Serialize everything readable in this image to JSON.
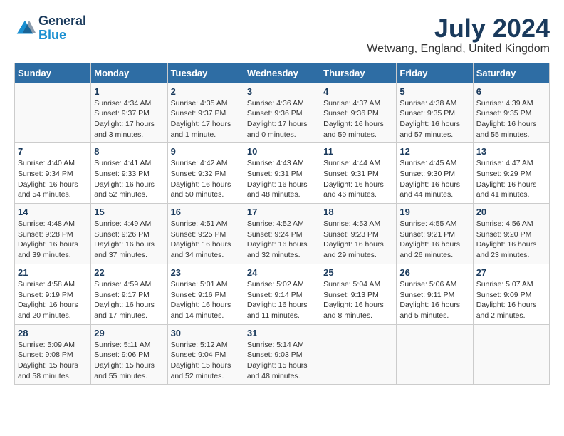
{
  "header": {
    "logo_general": "General",
    "logo_blue": "Blue",
    "title": "July 2024",
    "subtitle": "Wetwang, England, United Kingdom"
  },
  "days_of_week": [
    "Sunday",
    "Monday",
    "Tuesday",
    "Wednesday",
    "Thursday",
    "Friday",
    "Saturday"
  ],
  "weeks": [
    [
      {
        "day": "",
        "text": ""
      },
      {
        "day": "1",
        "text": "Sunrise: 4:34 AM\nSunset: 9:37 PM\nDaylight: 17 hours\nand 3 minutes."
      },
      {
        "day": "2",
        "text": "Sunrise: 4:35 AM\nSunset: 9:37 PM\nDaylight: 17 hours\nand 1 minute."
      },
      {
        "day": "3",
        "text": "Sunrise: 4:36 AM\nSunset: 9:36 PM\nDaylight: 17 hours\nand 0 minutes."
      },
      {
        "day": "4",
        "text": "Sunrise: 4:37 AM\nSunset: 9:36 PM\nDaylight: 16 hours\nand 59 minutes."
      },
      {
        "day": "5",
        "text": "Sunrise: 4:38 AM\nSunset: 9:35 PM\nDaylight: 16 hours\nand 57 minutes."
      },
      {
        "day": "6",
        "text": "Sunrise: 4:39 AM\nSunset: 9:35 PM\nDaylight: 16 hours\nand 55 minutes."
      }
    ],
    [
      {
        "day": "7",
        "text": "Sunrise: 4:40 AM\nSunset: 9:34 PM\nDaylight: 16 hours\nand 54 minutes."
      },
      {
        "day": "8",
        "text": "Sunrise: 4:41 AM\nSunset: 9:33 PM\nDaylight: 16 hours\nand 52 minutes."
      },
      {
        "day": "9",
        "text": "Sunrise: 4:42 AM\nSunset: 9:32 PM\nDaylight: 16 hours\nand 50 minutes."
      },
      {
        "day": "10",
        "text": "Sunrise: 4:43 AM\nSunset: 9:31 PM\nDaylight: 16 hours\nand 48 minutes."
      },
      {
        "day": "11",
        "text": "Sunrise: 4:44 AM\nSunset: 9:31 PM\nDaylight: 16 hours\nand 46 minutes."
      },
      {
        "day": "12",
        "text": "Sunrise: 4:45 AM\nSunset: 9:30 PM\nDaylight: 16 hours\nand 44 minutes."
      },
      {
        "day": "13",
        "text": "Sunrise: 4:47 AM\nSunset: 9:29 PM\nDaylight: 16 hours\nand 41 minutes."
      }
    ],
    [
      {
        "day": "14",
        "text": "Sunrise: 4:48 AM\nSunset: 9:28 PM\nDaylight: 16 hours\nand 39 minutes."
      },
      {
        "day": "15",
        "text": "Sunrise: 4:49 AM\nSunset: 9:26 PM\nDaylight: 16 hours\nand 37 minutes."
      },
      {
        "day": "16",
        "text": "Sunrise: 4:51 AM\nSunset: 9:25 PM\nDaylight: 16 hours\nand 34 minutes."
      },
      {
        "day": "17",
        "text": "Sunrise: 4:52 AM\nSunset: 9:24 PM\nDaylight: 16 hours\nand 32 minutes."
      },
      {
        "day": "18",
        "text": "Sunrise: 4:53 AM\nSunset: 9:23 PM\nDaylight: 16 hours\nand 29 minutes."
      },
      {
        "day": "19",
        "text": "Sunrise: 4:55 AM\nSunset: 9:21 PM\nDaylight: 16 hours\nand 26 minutes."
      },
      {
        "day": "20",
        "text": "Sunrise: 4:56 AM\nSunset: 9:20 PM\nDaylight: 16 hours\nand 23 minutes."
      }
    ],
    [
      {
        "day": "21",
        "text": "Sunrise: 4:58 AM\nSunset: 9:19 PM\nDaylight: 16 hours\nand 20 minutes."
      },
      {
        "day": "22",
        "text": "Sunrise: 4:59 AM\nSunset: 9:17 PM\nDaylight: 16 hours\nand 17 minutes."
      },
      {
        "day": "23",
        "text": "Sunrise: 5:01 AM\nSunset: 9:16 PM\nDaylight: 16 hours\nand 14 minutes."
      },
      {
        "day": "24",
        "text": "Sunrise: 5:02 AM\nSunset: 9:14 PM\nDaylight: 16 hours\nand 11 minutes."
      },
      {
        "day": "25",
        "text": "Sunrise: 5:04 AM\nSunset: 9:13 PM\nDaylight: 16 hours\nand 8 minutes."
      },
      {
        "day": "26",
        "text": "Sunrise: 5:06 AM\nSunset: 9:11 PM\nDaylight: 16 hours\nand 5 minutes."
      },
      {
        "day": "27",
        "text": "Sunrise: 5:07 AM\nSunset: 9:09 PM\nDaylight: 16 hours\nand 2 minutes."
      }
    ],
    [
      {
        "day": "28",
        "text": "Sunrise: 5:09 AM\nSunset: 9:08 PM\nDaylight: 15 hours\nand 58 minutes."
      },
      {
        "day": "29",
        "text": "Sunrise: 5:11 AM\nSunset: 9:06 PM\nDaylight: 15 hours\nand 55 minutes."
      },
      {
        "day": "30",
        "text": "Sunrise: 5:12 AM\nSunset: 9:04 PM\nDaylight: 15 hours\nand 52 minutes."
      },
      {
        "day": "31",
        "text": "Sunrise: 5:14 AM\nSunset: 9:03 PM\nDaylight: 15 hours\nand 48 minutes."
      },
      {
        "day": "",
        "text": ""
      },
      {
        "day": "",
        "text": ""
      },
      {
        "day": "",
        "text": ""
      }
    ]
  ]
}
